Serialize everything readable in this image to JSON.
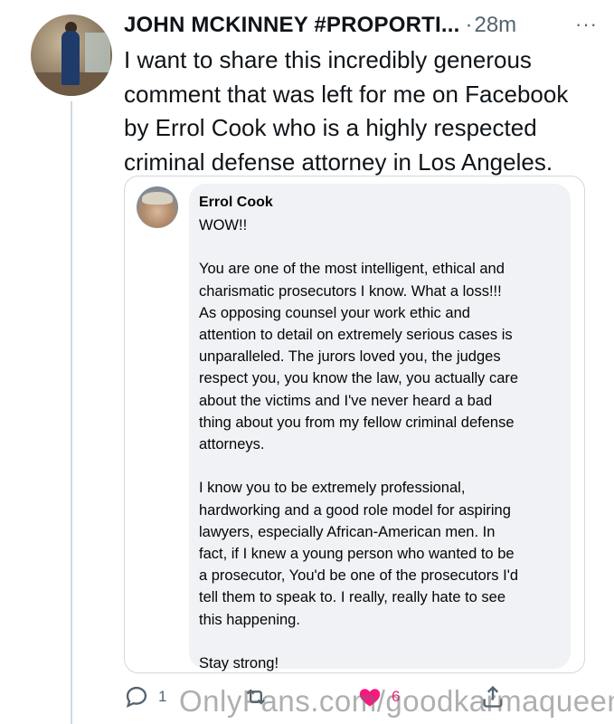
{
  "tweet": {
    "author_name": "JOHN MCKINNEY #PROPORTI...",
    "separator": "·",
    "time": "28m",
    "more_label": "···",
    "text": "I want to share this incredibly generous\ncomment that was left for me on Facebook\nby Errol Cook who is a highly respected\ncriminal  defense attorney  in Los Angeles."
  },
  "embedded_comment": {
    "author": "Errol Cook",
    "text": "WOW!!\n\nYou are one of the most intelligent, ethical and\ncharismatic prosecutors I know.  What a loss!!!\nAs opposing counsel your work ethic and\nattention to detail on extremely serious cases is\nunparalleled.  The jurors loved you, the judges\nrespect you, you know the law, you actually care\nabout the victims and I've never heard a bad\nthing about you from my fellow criminal defense\nattorneys.\n\nI know you to be extremely professional,\nhardworking and a good role model for aspiring\nlawyers, especially African-American men.  In\nfact, if I knew a young person who wanted to be\na prosecutor, You'd be one of the prosecutors I'd\ntell them to speak to.  I really, really hate to see\nthis happening.\n\nStay strong!"
  },
  "actions": {
    "reply_count": "1",
    "like_count": "6"
  },
  "watermark": "OnlyFans.com/goodkarmaqueen",
  "colors": {
    "text": "#0f1419",
    "muted": "#536471",
    "like": "#f91880",
    "bubble": "#f0f2f5",
    "border": "#cfd9de"
  }
}
